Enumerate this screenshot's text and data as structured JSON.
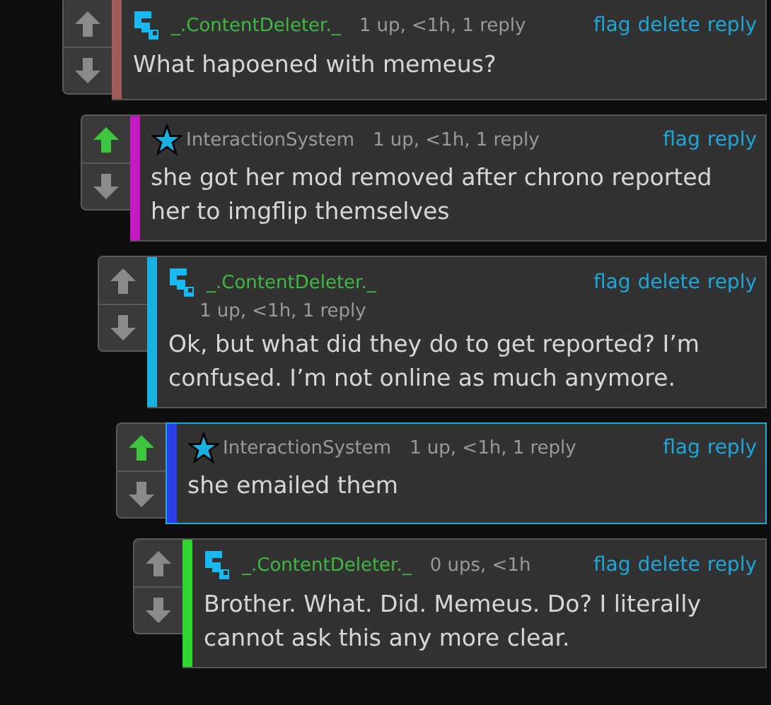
{
  "comments": [
    {
      "color": "#a05a5a",
      "upvoted": false,
      "highlighted": false,
      "kind": "blocks",
      "author": "_.ContentDeleter._",
      "meta": "1 up, <1h, 1 reply",
      "meta_wrapped": false,
      "actions": [
        "flag",
        "delete",
        "reply"
      ],
      "text": "What hapoened with memeus?",
      "children": [
        {
          "color": "#c21bc2",
          "upvoted": true,
          "highlighted": false,
          "kind": "star",
          "author": "InteractionSystem",
          "meta": "1 up, <1h, 1 reply",
          "meta_wrapped": false,
          "actions": [
            "flag",
            "reply"
          ],
          "text": "she got her mod removed after chrono reported her to imgflip themselves",
          "children": [
            {
              "color": "#1ab0e0",
              "upvoted": false,
              "highlighted": false,
              "kind": "blocks",
              "author": "_.ContentDeleter._",
              "meta": "1 up, <1h, 1 reply",
              "meta_wrapped": true,
              "actions": [
                "flag",
                "delete",
                "reply"
              ],
              "text": "Ok, but what did they do to get reported? I’m confused. I’m not online as much anymore.",
              "children": [
                {
                  "color": "#2a3fe8",
                  "upvoted": true,
                  "highlighted": true,
                  "kind": "star",
                  "author": "InteractionSystem",
                  "meta": "1 up, <1h, 1 reply",
                  "meta_wrapped": false,
                  "actions": [
                    "flag",
                    "reply"
                  ],
                  "text": "she emailed them",
                  "children": [
                    {
                      "color": "#2fd62f",
                      "upvoted": false,
                      "highlighted": false,
                      "kind": "blocks",
                      "author": "_.ContentDeleter._",
                      "meta": "0 ups, <1h",
                      "meta_wrapped": false,
                      "actions": [
                        "flag",
                        "delete",
                        "reply"
                      ],
                      "text": "Brother. What. Did. Memeus. Do? I literally cannot ask this any more clear."
                    }
                  ]
                }
              ]
            }
          ]
        }
      ]
    }
  ]
}
